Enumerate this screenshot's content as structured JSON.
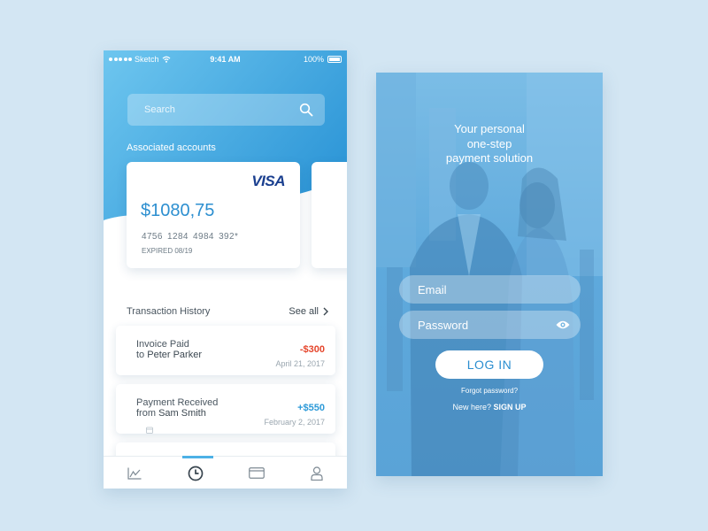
{
  "colors": {
    "page_background": "#d3e6f3",
    "brand_blue": "#3aa3e0",
    "amount_negative": "#e5452b",
    "amount_positive": "#2d9ad8",
    "visa_blue": "#1a3f8f"
  },
  "status_bar": {
    "carrier": "Sketch",
    "time": "9:41 AM",
    "battery": "100%"
  },
  "search": {
    "placeholder": "Search",
    "icon": "search-icon"
  },
  "accounts": {
    "label": "Associated accounts",
    "card": {
      "brand": "VISA",
      "balance": "$1080,75",
      "number": "4756  1284  4984  392*",
      "expiry": "EXPIRED 08/19"
    }
  },
  "transactions": {
    "title": "Transaction History",
    "see_all": "See all",
    "items": [
      {
        "title": "Invoice Paid",
        "prefix": "to",
        "party": "Peter Parker",
        "amount": "-$300",
        "date": "April 21, 2017"
      },
      {
        "title": "Payment Received",
        "prefix": "from",
        "party": "Sam Smith",
        "amount": "+$550",
        "date": "February 2, 2017"
      }
    ]
  },
  "tab_bar": {
    "tabs": [
      {
        "icon": "chart-icon",
        "active": false
      },
      {
        "icon": "clock-icon",
        "active": true
      },
      {
        "icon": "card-icon",
        "active": false
      },
      {
        "icon": "profile-icon",
        "active": false
      }
    ]
  },
  "login": {
    "tagline_line1": "Your personal",
    "tagline_line2": "one-step",
    "tagline_line3": "payment solution",
    "email_placeholder": "Email",
    "password_placeholder": "Password",
    "password_icon": "eye-icon",
    "login_button": "LOG IN",
    "forgot_password": "Forgot password?",
    "new_here": "New here?",
    "sign_up": "SIGN UP"
  }
}
